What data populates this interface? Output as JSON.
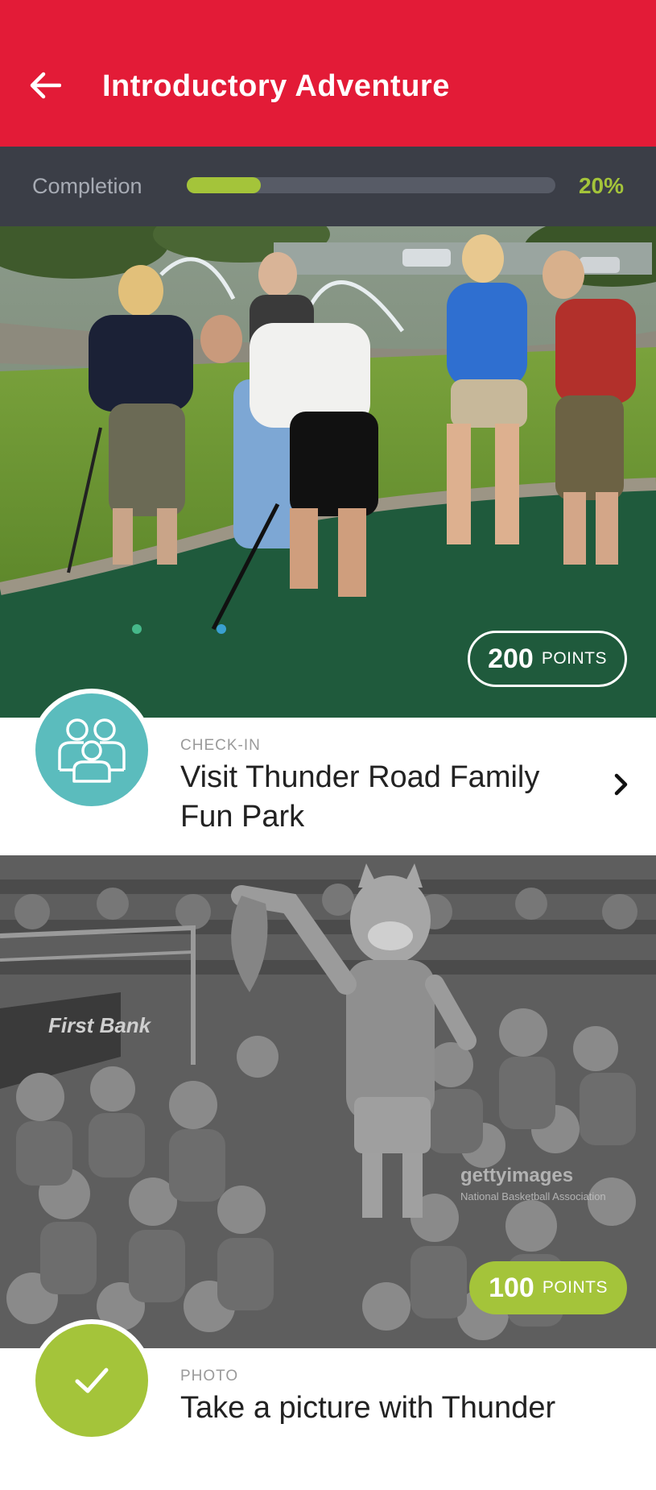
{
  "header": {
    "title": "Introductory Adventure",
    "back_icon": "arrow-left-icon",
    "color": "#e31b37"
  },
  "progress": {
    "label": "Completion",
    "value": 0.2,
    "percent_text": "20%",
    "accent": "#a4c43a"
  },
  "activities": [
    {
      "image": "mini-golf-photo",
      "points_value": "200",
      "points_label": "POINTS",
      "type": "CHECK-IN",
      "title": "Visit Thunder Road Family Fun Park",
      "icon": "group-people-icon",
      "badge_color": "#5bbcbd",
      "completed": false
    },
    {
      "image": "mascot-crowd-photo",
      "points_value": "100",
      "points_label": "POINTS",
      "type": "PHOTO",
      "title": "Take a picture with Thunder",
      "icon": "checkmark-icon",
      "badge_color": "#a4c43a",
      "completed": true,
      "watermark_brand": "gettyimages",
      "watermark_caption": "National Basketball Association",
      "jersey_text": "First Bank"
    }
  ]
}
